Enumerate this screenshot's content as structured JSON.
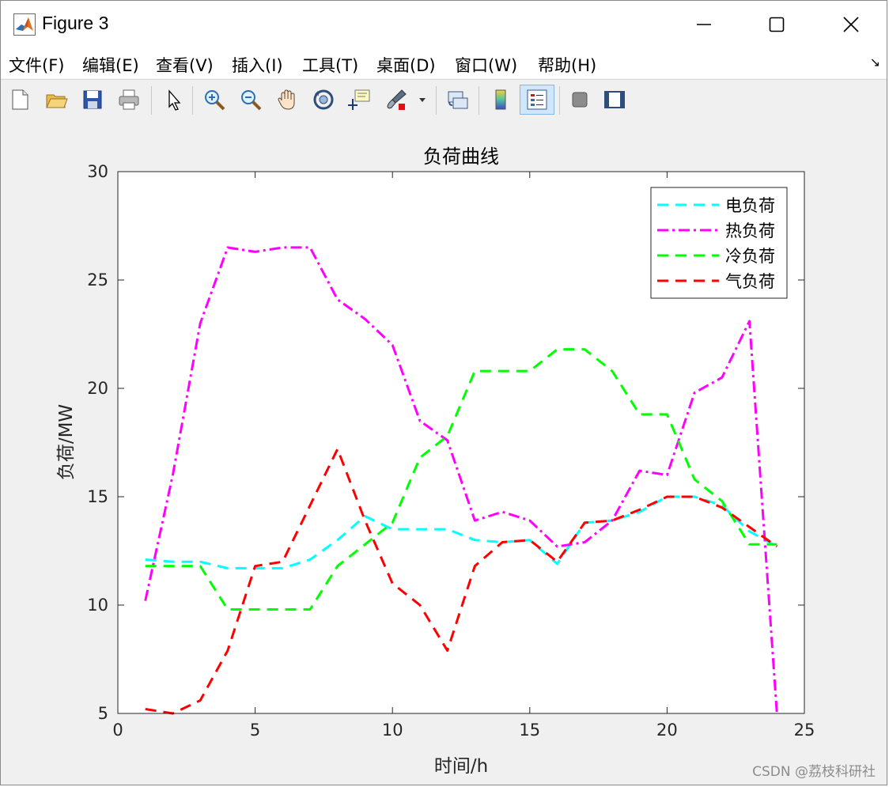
{
  "window": {
    "title": "Figure 3",
    "minimize_label": "minimize",
    "maximize_label": "maximize",
    "close_label": "close"
  },
  "menubar": {
    "items": [
      {
        "label": "文件(F)"
      },
      {
        "label": "编辑(E)"
      },
      {
        "label": "查看(V)"
      },
      {
        "label": "插入(I)"
      },
      {
        "label": "工具(T)"
      },
      {
        "label": "桌面(D)"
      },
      {
        "label": "窗口(W)"
      },
      {
        "label": "帮助(H)"
      }
    ]
  },
  "toolbar": {
    "icons": [
      "new-figure-icon",
      "open-file-icon",
      "save-icon",
      "print-icon",
      "select-arrow-icon",
      "zoom-in-icon",
      "zoom-out-icon",
      "pan-hand-icon",
      "rotate-3d-icon",
      "data-cursor-icon",
      "brush-icon",
      "brush-dropdown-icon",
      "link-plot-icon",
      "colorbar-icon",
      "legend-icon",
      "hide-plot-tools-icon",
      "show-plot-tools-icon"
    ]
  },
  "chart_data": {
    "type": "line",
    "title": "负荷曲线",
    "xlabel": "时间/h",
    "ylabel": "负荷/MW",
    "xlim": [
      0,
      25
    ],
    "ylim": [
      5,
      30
    ],
    "xticks": [
      0,
      5,
      10,
      15,
      20,
      25
    ],
    "yticks": [
      5,
      10,
      15,
      20,
      25,
      30
    ],
    "grid": false,
    "legend_position": "top-right",
    "x": [
      1,
      2,
      3,
      4,
      5,
      6,
      7,
      8,
      9,
      10,
      11,
      12,
      13,
      14,
      15,
      16,
      17,
      18,
      19,
      20,
      21,
      22,
      23,
      24
    ],
    "series": [
      {
        "name": "电负荷",
        "color": "#00ffff",
        "style": "dash",
        "values": [
          12.1,
          12.0,
          12.0,
          11.7,
          11.7,
          11.7,
          12.1,
          13.0,
          14.1,
          13.5,
          13.5,
          13.5,
          13.0,
          12.9,
          13.0,
          11.9,
          13.8,
          13.9,
          14.3,
          15.0,
          15.0,
          14.6,
          13.4,
          12.7
        ]
      },
      {
        "name": "热负荷",
        "color": "#ff00ff",
        "style": "dashdot",
        "values": [
          10.2,
          16.0,
          23.0,
          26.5,
          26.3,
          26.5,
          26.5,
          24.1,
          23.2,
          22.0,
          18.5,
          17.6,
          13.9,
          14.3,
          13.9,
          12.7,
          12.9,
          13.9,
          16.2,
          16.0,
          19.8,
          20.5,
          23.1,
          5.0
        ]
      },
      {
        "name": "冷负荷",
        "color": "#00ff00",
        "style": "dash",
        "values": [
          11.8,
          11.8,
          11.8,
          9.8,
          9.8,
          9.8,
          9.8,
          11.8,
          12.8,
          13.8,
          16.8,
          17.8,
          20.8,
          20.8,
          20.8,
          21.8,
          21.8,
          20.8,
          18.8,
          18.8,
          15.8,
          14.8,
          12.8,
          12.8
        ]
      },
      {
        "name": "气负荷",
        "color": "#ff0000",
        "style": "dash",
        "values": [
          5.2,
          5.0,
          5.6,
          7.9,
          11.8,
          12.0,
          14.6,
          17.2,
          13.9,
          11.0,
          10.0,
          7.9,
          11.8,
          12.9,
          13.0,
          12.0,
          13.8,
          13.9,
          14.4,
          15.0,
          15.0,
          14.5,
          13.6,
          12.7
        ]
      }
    ]
  },
  "watermark": "CSDN @荔枝科研社"
}
